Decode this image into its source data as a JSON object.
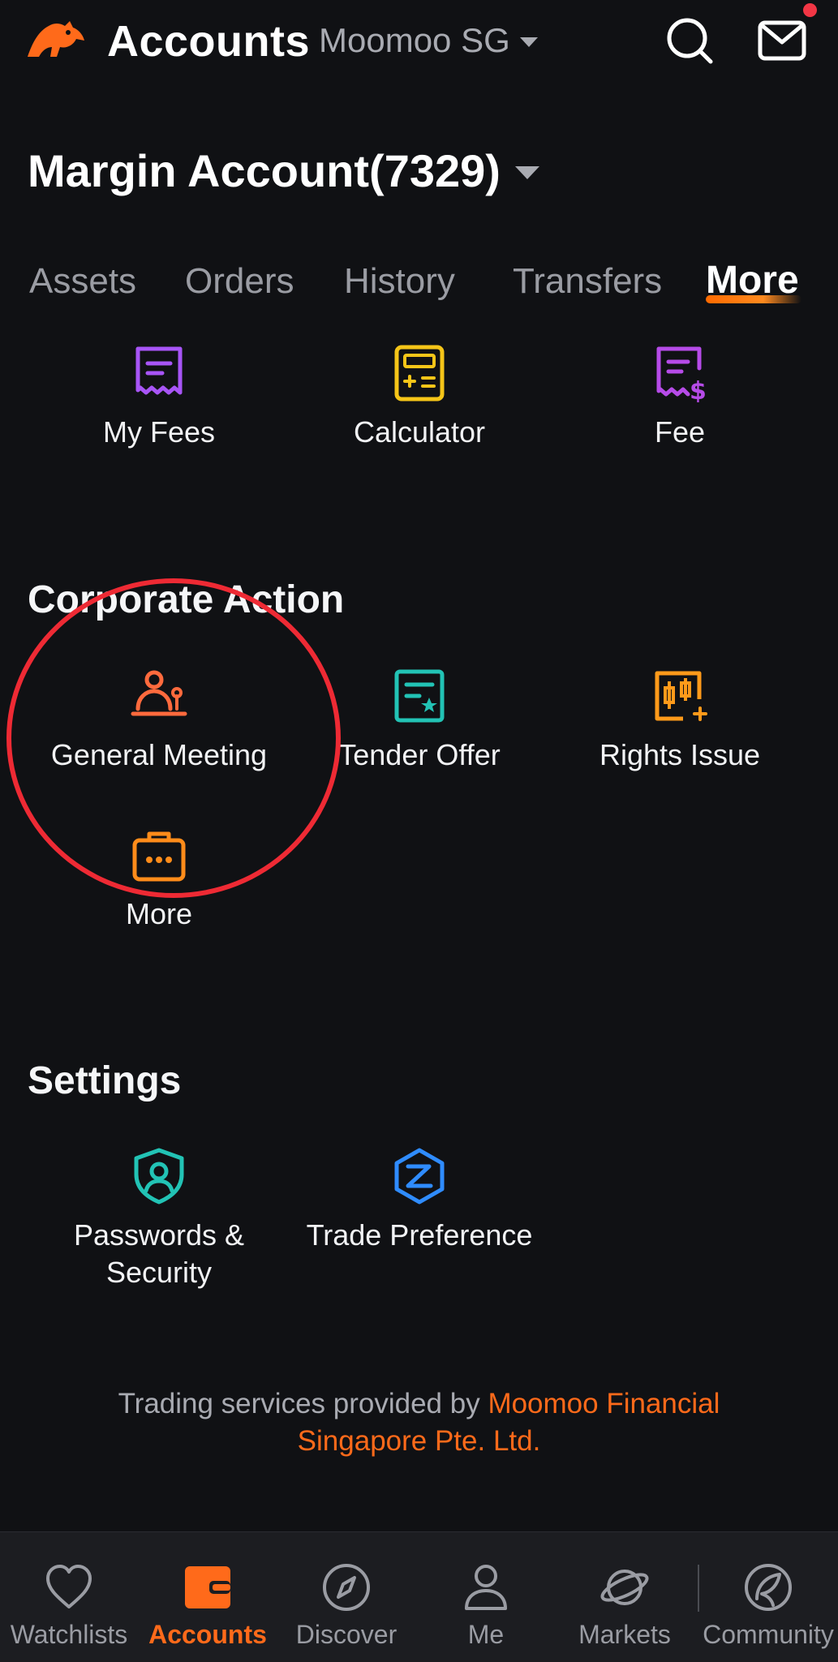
{
  "header": {
    "title": "Accounts",
    "broker": "Moomoo SG",
    "icons": [
      "moomoo-logo",
      "search-icon",
      "mail-icon"
    ],
    "has_notification_dot": true
  },
  "account": {
    "name": "Margin Account(7329)"
  },
  "tabs": [
    {
      "label": "Assets",
      "active": false
    },
    {
      "label": "Orders",
      "active": false
    },
    {
      "label": "History",
      "active": false
    },
    {
      "label": "Transfers",
      "active": false
    },
    {
      "label": "More",
      "active": true
    }
  ],
  "tools": {
    "items": [
      {
        "label": "My Fees",
        "icon": "receipt-icon",
        "color": "#A855F7"
      },
      {
        "label": "Calculator",
        "icon": "calculator-icon",
        "color": "#F5C518"
      },
      {
        "label": "Fee",
        "icon": "fee-bill-icon",
        "color": "#B64BE8"
      }
    ]
  },
  "corporate_action": {
    "title": "Corporate Action",
    "items": [
      {
        "label": "General Meeting",
        "icon": "meeting-icon",
        "color": "#FF6A3D"
      },
      {
        "label": "Tender Offer",
        "icon": "tender-offer-icon",
        "color": "#22C3B5"
      },
      {
        "label": "Rights Issue",
        "icon": "rights-issue-icon",
        "color": "#FF9A1A"
      },
      {
        "label": "More",
        "icon": "more-briefcase-icon",
        "color": "#FF8C1A"
      }
    ]
  },
  "settings": {
    "title": "Settings",
    "items": [
      {
        "label_line1": "Passwords &",
        "label_line2": "Security",
        "icon": "shield-user-icon",
        "color": "#22C3B5"
      },
      {
        "label": "Trade Preference",
        "icon": "trade-preference-icon",
        "color": "#2F8CFF"
      }
    ]
  },
  "footer": {
    "prefix": "Trading services provided by ",
    "link": "Moomoo Financial Singapore Pte. Ltd."
  },
  "bottom_nav": [
    {
      "label": "Watchlists",
      "icon": "heart-icon",
      "active": false
    },
    {
      "label": "Accounts",
      "icon": "wallet-icon",
      "active": true
    },
    {
      "label": "Discover",
      "icon": "compass-icon",
      "active": false
    },
    {
      "label": "Me",
      "icon": "person-icon",
      "active": false
    },
    {
      "label": "Markets",
      "icon": "planet-icon",
      "active": false
    },
    {
      "label": "Community",
      "icon": "community-icon",
      "active": false
    }
  ],
  "colors": {
    "background": "#101114",
    "accent": "#FF6A1A",
    "annotation_circle": "#EE2A34"
  }
}
